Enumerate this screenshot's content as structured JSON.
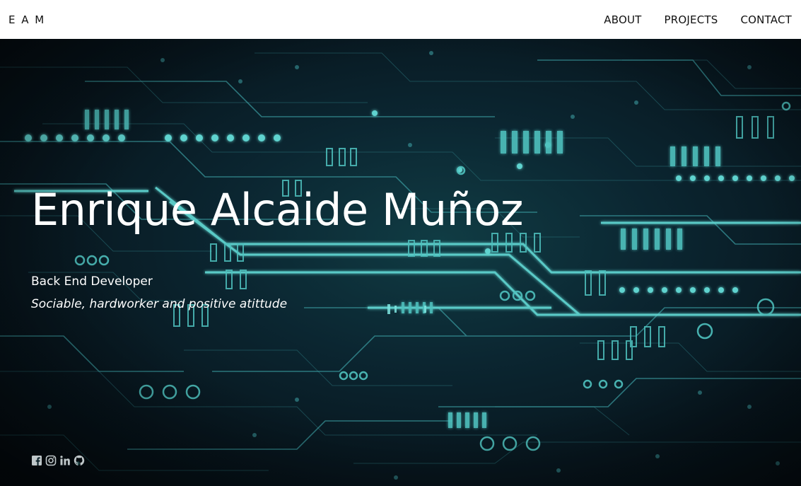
{
  "nav": {
    "brand": "E A M",
    "links": [
      "ABOUT",
      "PROJECTS",
      "CONTACT"
    ]
  },
  "hero": {
    "title": "Enrique Alcaide Muñoz",
    "role": "Back End Developer",
    "tagline": "Sociable, hardworker and positive atittude"
  },
  "socials": [
    "facebook-icon",
    "instagram-icon",
    "linkedin-icon",
    "github-icon"
  ],
  "colors": {
    "circuit": "#5fd3cf",
    "hero_bg": "#0b2631",
    "nav_bg": "#ffffff",
    "text_light": "#ffffff",
    "social_icon": "#bfc7c9"
  }
}
